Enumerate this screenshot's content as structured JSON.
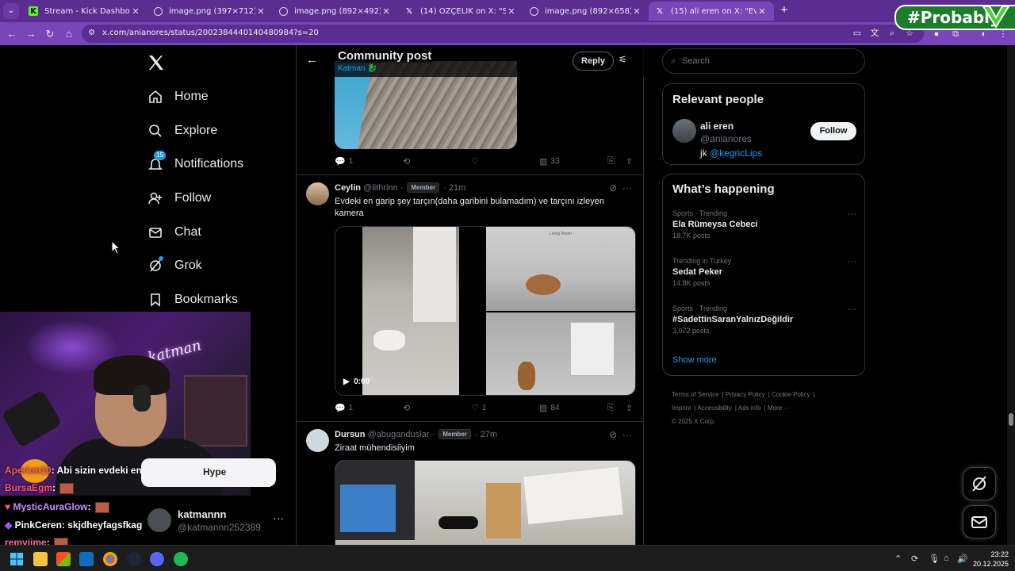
{
  "browser": {
    "tabs": [
      {
        "title": "Stream - Kick Dashboard",
        "favicon": "kick-icon",
        "active": false
      },
      {
        "title": "image.png (397×712)",
        "favicon": "globe-icon",
        "active": false
      },
      {
        "title": "image.png (892×492)",
        "favicon": "globe-icon",
        "active": false
      },
      {
        "title": "(14) ÖZÇELİK on X: \"Sağol abi c",
        "favicon": "x-icon",
        "active": false
      },
      {
        "title": "image.png (892×658)",
        "favicon": "globe-icon",
        "active": false
      },
      {
        "title": "(15) ali eren on X: \"Evinizdeki e",
        "favicon": "x-icon",
        "active": true
      }
    ],
    "url": "x.com/anianores/status/2002384440140480984?s=20",
    "theme_color": "#7a45b8"
  },
  "overlay": {
    "badge_text": "#Probably"
  },
  "nav": {
    "items": [
      {
        "label": "Home",
        "icon": "home-icon"
      },
      {
        "label": "Explore",
        "icon": "search-icon"
      },
      {
        "label": "Notifications",
        "icon": "bell-icon",
        "badge": "15"
      },
      {
        "label": "Follow",
        "icon": "person-plus-icon"
      },
      {
        "label": "Chat",
        "icon": "mail-icon"
      },
      {
        "label": "Grok",
        "icon": "grok-icon"
      },
      {
        "label": "Bookmarks",
        "icon": "bookmark-icon"
      }
    ],
    "account": {
      "name": "katmannn",
      "handle": "@katmannn252389",
      "more": "···"
    }
  },
  "stream_chat": {
    "lines": [
      {
        "user": "Aperion10",
        "color": "#ff5a5a",
        "text": ": Abi sizin evdeki en garip şey ne @Hype"
      },
      {
        "user": "BursaEgm",
        "color": "#ff4f7b",
        "text": ":",
        "emote": true
      },
      {
        "user": "MysticAuraGlow",
        "color": "#c98cff",
        "text": ":",
        "emote": true
      },
      {
        "user": "PinkCeren",
        "color": "#ffffff",
        "text": ": skjdheyfagsfkag"
      },
      {
        "user": "remyiime",
        "color": "#ff6aa8",
        "text": ":",
        "emote": true
      }
    ],
    "hype_label": "Hype"
  },
  "post_header": {
    "title": "Community post",
    "community": "Katman 🐉",
    "reply_label": "Reply"
  },
  "posts": [
    {
      "actions": {
        "replies": "1",
        "reposts": "",
        "likes": "",
        "views": "33"
      }
    },
    {
      "name": "Ceylin",
      "handle": "@lithrinn",
      "badge": "Member",
      "time": "21m",
      "text": "Evdeki en garip şey tarçın(daha garibini bulamadım) ve tarçını izleyen kamera",
      "video_time": "0:00",
      "video_label": "Living Room",
      "actions": {
        "replies": "1",
        "reposts": "",
        "likes": "1",
        "views": "84"
      }
    },
    {
      "name": "Dursun",
      "handle": "@abuganduslar",
      "badge": "Member",
      "time": "27m",
      "text": "Ziraat mühendisiiyim"
    }
  ],
  "sidebar": {
    "search_placeholder": "Search",
    "relevant_people": {
      "heading": "Relevant people",
      "name": "ali eren",
      "handle": "@anianores",
      "bio_prefix": "jk ",
      "bio_link": "@kegricLips",
      "follow_label": "Follow"
    },
    "happening": {
      "heading": "What’s happening",
      "trends": [
        {
          "context": "Sports · Trending",
          "title": "Ela Rümeysa Cebeci",
          "count": "18.7K posts"
        },
        {
          "context": "Trending in Turkey",
          "title": "Sedat Peker",
          "count": "14.8K posts"
        },
        {
          "context": "Sports · Trending",
          "title": "#SadettinSaranYalnızDeğildir",
          "count": "3,072 posts"
        }
      ],
      "show_more": "Show more"
    },
    "footer": [
      "Terms of Service",
      "Privacy Policy",
      "Cookie Policy",
      "Imprint",
      "Accessibility",
      "Ads info",
      "More ···",
      "© 2025 X Corp."
    ]
  },
  "taskbar": {
    "clock_time": "23:22",
    "clock_date": "20.12.2025"
  }
}
